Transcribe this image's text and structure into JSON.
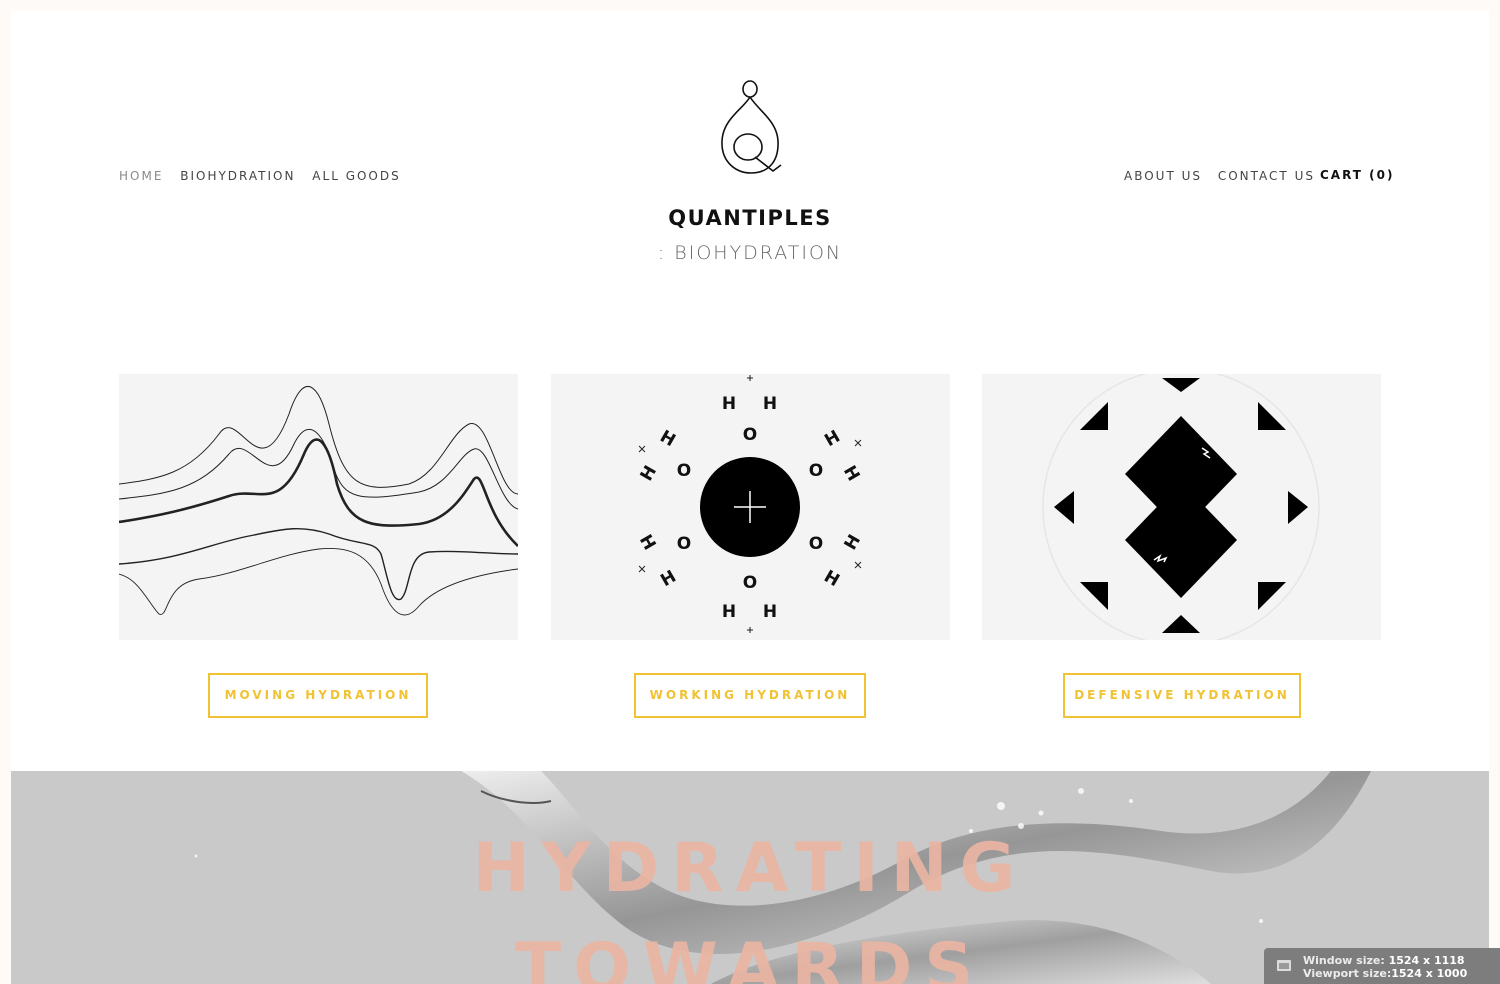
{
  "nav": {
    "left": [
      "HOME",
      "BIOHYDRATION",
      "ALL GOODS"
    ],
    "right": [
      "ABOUT US",
      "CONTACT US"
    ],
    "cart": "CART (0)"
  },
  "brand": {
    "name": "QUANTIPLES",
    "sub": ": BIOHYDRATION"
  },
  "cards": [
    {
      "button": "MOVING HYDRATION"
    },
    {
      "button": "WORKING HYDRATION"
    },
    {
      "button": "DEFENSIVE HYDRATION"
    }
  ],
  "hero": {
    "line1": "HYDRATING",
    "line2": "TOWARDS"
  },
  "badge": {
    "window_label": "Window size:",
    "window_value": "1524 x 1118",
    "viewport_label": "Viewport size:",
    "viewport_value": "1524 x 1000"
  },
  "colors": {
    "accent": "#f1c232",
    "hero_text": "#eab5a3"
  }
}
